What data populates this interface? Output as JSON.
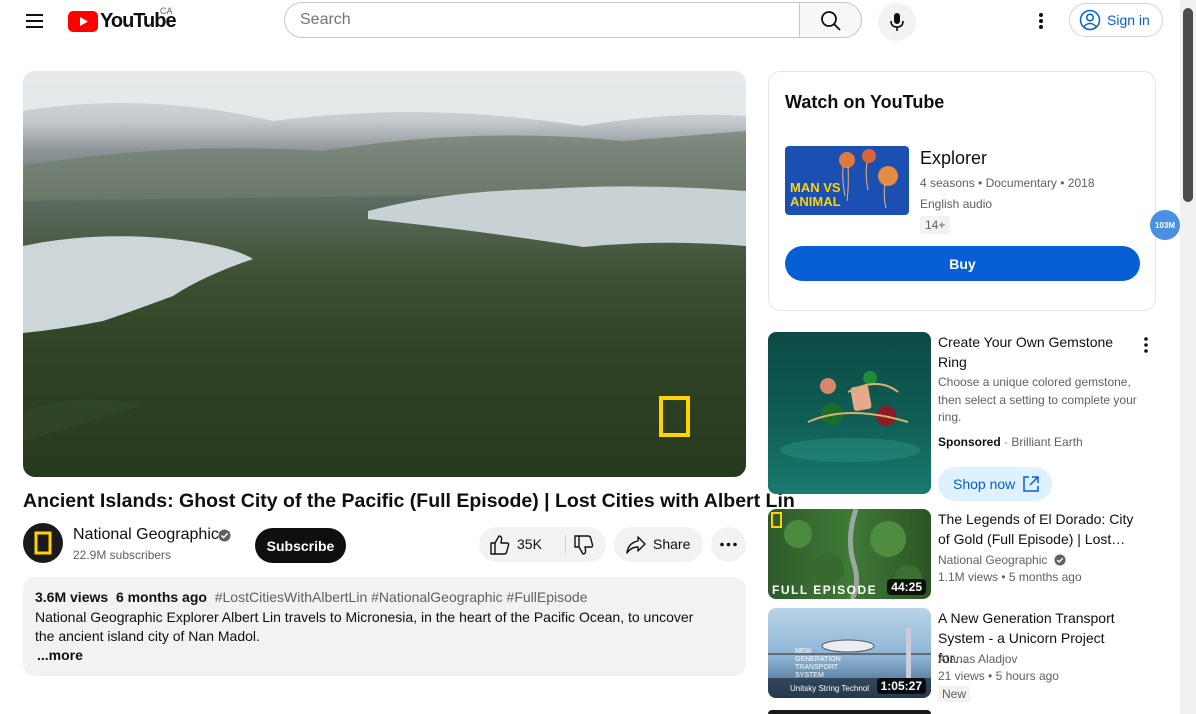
{
  "header": {
    "logo_text": "YouTube",
    "region": "CA",
    "search_placeholder": "Search",
    "signin_label": "Sign in"
  },
  "video": {
    "title": "Ancient Islands: Ghost City of the Pacific (Full Episode) | Lost Cities with Albert Lin",
    "channel_name": "National Geographic",
    "subscribers": "22.9M subscribers",
    "subscribe_label": "Subscribe",
    "likes": "35K",
    "share_label": "Share"
  },
  "description": {
    "views": "3.6M views",
    "age": "6 months ago",
    "hashtags": "#LostCitiesWithAlbertLin #NationalGeographic #FullEpisode",
    "text": "National Geographic Explorer Albert Lin travels to Micronesia, in the heart of the Pacific Ocean, to uncover the ancient island city of Nan Madol.",
    "more_label": "...more"
  },
  "watch_card": {
    "heading": "Watch on YouTube",
    "thumb_text_1": "MAN VS",
    "thumb_text_2": "ANIMAL",
    "title": "Explorer",
    "meta": "4 seasons • Documentary • 2018",
    "audio": "English audio",
    "rating": "14+",
    "buy_label": "Buy"
  },
  "notification_bubble": "103M",
  "ad": {
    "title": "Create Your Own Gemstone Ring",
    "description": "Choose a unique colored gemstone, then select a setting to complete your ring.",
    "sponsored_label": "Sponsored",
    "advertiser": "Brilliant Earth",
    "cta_label": "Shop now"
  },
  "recommendations": [
    {
      "title": "The Legends of El Dorado: City of Gold (Full Episode) | Lost…",
      "channel": "National Geographic",
      "views": "1.1M views",
      "age": "5 months ago",
      "duration": "44:25",
      "thumb_text": "FULL EPISODE"
    },
    {
      "title": "A New Generation Transport System - a Unicorn Project for…",
      "channel": "Atanas Aladjov",
      "views": "21 views",
      "age": "5 hours ago",
      "duration": "1:05:27",
      "badge": "New",
      "thumb_text_1": "NEW",
      "thumb_text_2": "GENERATION",
      "thumb_text_3": "TRANSPORT",
      "thumb_text_4": "SYSTEM",
      "thumb_caption": "Unitsky String Technol"
    }
  ],
  "colors": {
    "youtube_red": "#ff0000",
    "link_blue": "#065fd4",
    "natgeo_yellow": "#ffd200"
  }
}
